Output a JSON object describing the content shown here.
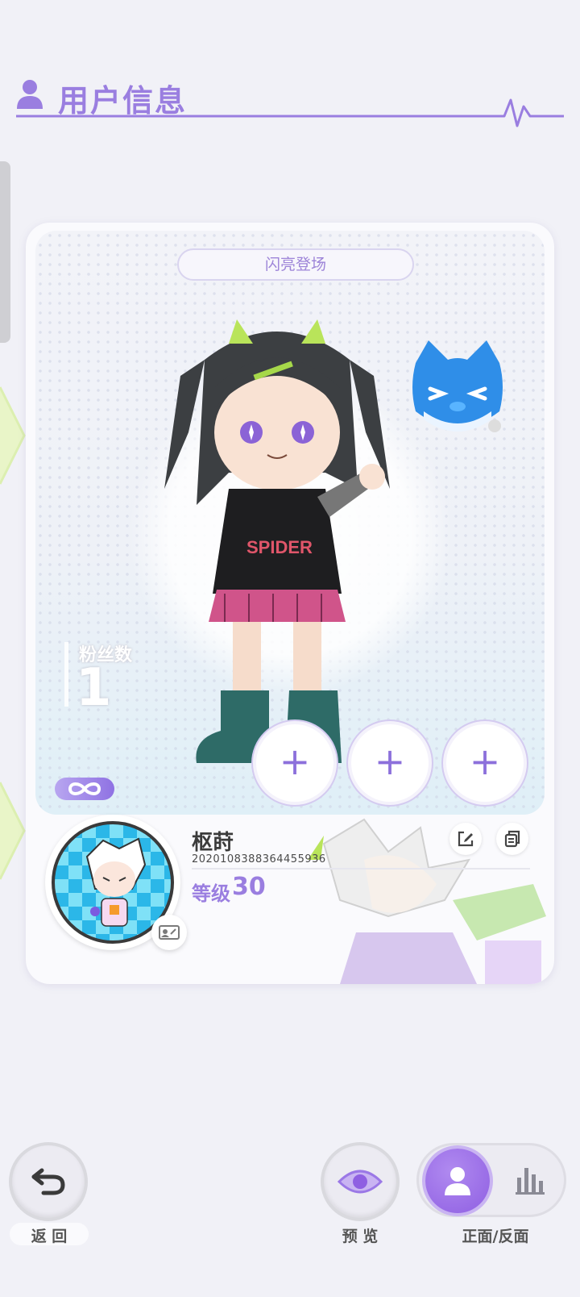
{
  "header": {
    "title": "用户信息",
    "icon": "user-icon"
  },
  "card": {
    "banner_title": "闪亮登场",
    "fans_label": "粉丝数",
    "fans_count": "1",
    "infinity_badge_icon": "infinity-icon",
    "add_slots": [
      "+",
      "+",
      "+"
    ]
  },
  "profile": {
    "username": "枢莳",
    "user_id": "2020108388364455936",
    "level_label": "等级",
    "level_value": "30",
    "edit_icon": "pencil-edit-icon",
    "copy_icon": "copy-icon",
    "avatar_edit_icon": "id-card-edit-icon"
  },
  "bottom_bar": {
    "back_label": "返 回",
    "preview_label": "预 览",
    "side_toggle_label": "正面/反面"
  },
  "colors": {
    "accent": "#9a7ee0",
    "background": "#f1f1f7",
    "card": "#fafafd"
  }
}
